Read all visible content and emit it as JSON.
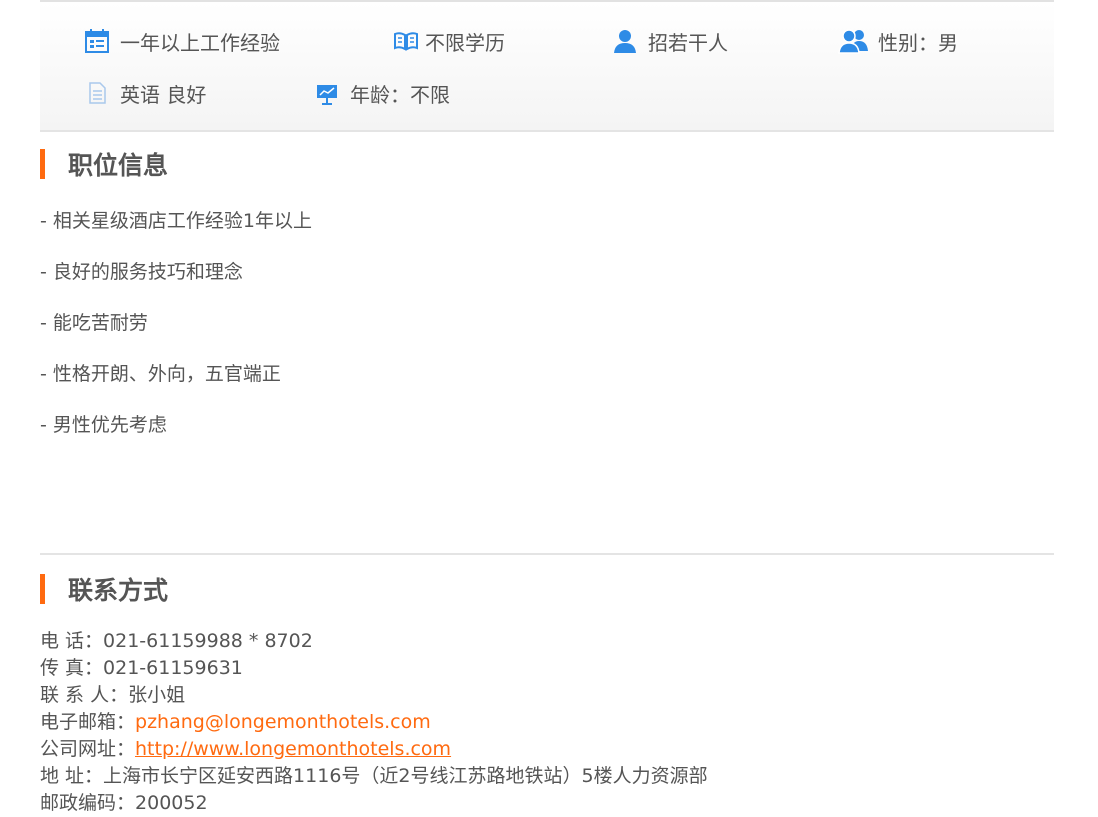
{
  "requirements": {
    "experience": "一年以上工作经验",
    "education": "不限学历",
    "headcount": "招若干人",
    "gender": "性别：男",
    "language": "英语 良好",
    "age": "年龄：不限"
  },
  "job_info": {
    "title": "职位信息",
    "duties": [
      "- 相关星级酒店工作经验1年以上",
      "- 良好的服务技巧和理念",
      "- 能吃苦耐劳",
      "- 性格开朗、外向，五官端正",
      "- 男性优先考虑"
    ]
  },
  "contact": {
    "title": "联系方式",
    "phone_label": "电 话：",
    "phone": "021-61159988 * 8702",
    "fax_label": "传 真：",
    "fax": "021-61159631",
    "person_label": "联 系 人：",
    "person": "张小姐",
    "email_label": "电子邮箱：",
    "email": "pzhang@longemonthotels.com",
    "website_label": "公司网址：",
    "website": "http://www.longemonthotels.com",
    "address_label": "地 址：",
    "address": "上海市长宁区延安西路1116号（近2号线江苏路地铁站）5楼人力资源部",
    "postcode_label": "邮政编码：",
    "postcode": "200052"
  },
  "colors": {
    "accent": "#ff6a10",
    "icon_blue": "#2e8be6",
    "text": "#555555",
    "divider": "#e4e4e4"
  },
  "icons": [
    "calendar-icon",
    "book-icon",
    "person-icon",
    "people-icon",
    "document-icon",
    "presentation-icon"
  ]
}
